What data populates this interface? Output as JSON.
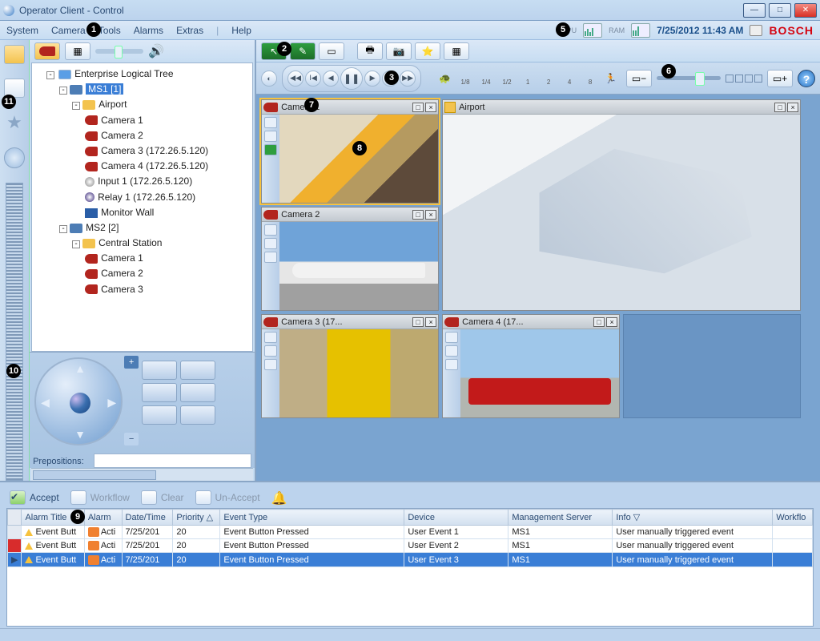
{
  "window": {
    "title": "Operator Client - Control"
  },
  "menu": {
    "items": [
      "System",
      "Camera",
      "Tools",
      "Alarms",
      "Extras",
      "Help"
    ],
    "cpu_label": "CPU",
    "ram_label": "RAM",
    "datetime": "7/25/2012 11:43 AM",
    "brand": "BOSCH"
  },
  "tree": {
    "root": "Enterprise Logical Tree",
    "ms1": {
      "label": "MS1 [1]",
      "airport": "Airport",
      "items": [
        "Camera 1",
        "Camera 2",
        "Camera 3 (172.26.5.120)",
        "Camera 4 (172.26.5.120)",
        "Input 1 (172.26.5.120)",
        "Relay 1 (172.26.5.120)",
        "Monitor Wall"
      ]
    },
    "ms2": {
      "label": "MS2 [2]",
      "station": "Central Station",
      "items": [
        "Camera 1",
        "Camera 2",
        "Camera 3"
      ]
    }
  },
  "ptz": {
    "prepositions_label": "Prepositions:"
  },
  "playback": {
    "speeds": [
      "1/8",
      "1/4",
      "1/2",
      "1",
      "2",
      "4",
      "8"
    ]
  },
  "panes": {
    "cam1": "Camera 1",
    "cam2": "Camera 2",
    "cam3": "Camera 3 (17...",
    "cam4": "Camera 4 (17...",
    "map": "Airport"
  },
  "alarm_toolbar": {
    "accept": "Accept",
    "workflow": "Workflow",
    "clear": "Clear",
    "unaccept": "Un-Accept"
  },
  "alarm_grid": {
    "headers": [
      "",
      "Alarm Title",
      "Alarm",
      "Date/Time",
      "Priority",
      "Event Type",
      "Device",
      "Management Server",
      "Info",
      "Workflo"
    ],
    "rows": [
      {
        "title": "Event Butt",
        "alarm": "Acti",
        "dt": "7/25/201",
        "prio": "20",
        "etype": "Event Button Pressed",
        "device": "User Event 1",
        "mgmt": "MS1",
        "info": "User manually triggered event"
      },
      {
        "title": "Event Butt",
        "alarm": "Acti",
        "dt": "7/25/201",
        "prio": "20",
        "etype": "Event Button Pressed",
        "device": "User Event 2",
        "mgmt": "MS1",
        "info": "User manually triggered event"
      },
      {
        "title": "Event Butt",
        "alarm": "Acti",
        "dt": "7/25/201",
        "prio": "20",
        "etype": "Event Button Pressed",
        "device": "User Event 3",
        "mgmt": "MS1",
        "info": "User manually triggered event"
      }
    ]
  },
  "callouts": {
    "c1": "1",
    "c2": "2",
    "c3": "3",
    "c4": "",
    "c5": "5",
    "c6": "6",
    "c7": "7",
    "c8": "8",
    "c9": "9",
    "c10": "10",
    "c11": "11"
  }
}
